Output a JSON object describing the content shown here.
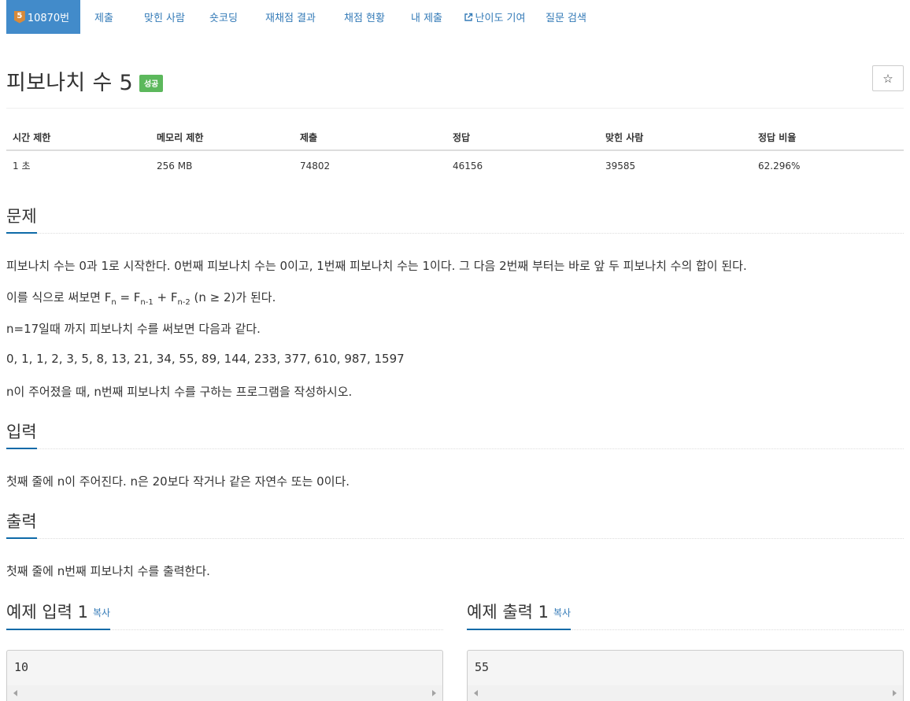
{
  "nav": {
    "problem_number": "10870번",
    "tier_level": "5",
    "items": [
      "제출",
      "맞힌 사람",
      "숏코딩",
      "재채점 결과",
      "채점 현황",
      "내 제출",
      "난이도 기여",
      "질문 검색"
    ]
  },
  "problem": {
    "title": "피보나치 수 5",
    "result_badge": "성공",
    "star_symbol": "☆"
  },
  "info_table": {
    "headers": [
      "시간 제한",
      "메모리 제한",
      "제출",
      "정답",
      "맞힌 사람",
      "정답 비율"
    ],
    "values": [
      "1 초",
      "256 MB",
      "74802",
      "46156",
      "39585",
      "62.296%"
    ]
  },
  "sections": {
    "description_title": "문제",
    "description": {
      "line1": "피보나치 수는 0과 1로 시작한다. 0번째 피보나치 수는 0이고, 1번째 피보나치 수는 1이다. 그 다음 2번째 부터는 바로 앞 두 피보나치 수의 합이 된다.",
      "line2_prefix": "이를 식으로 써보면 F",
      "sub_n": "n",
      "line2_eq": " = F",
      "sub_n1": "n-1",
      "line2_plus": " + F",
      "sub_n2": "n-2",
      "line2_suffix": " (n ≥ 2)가 된다.",
      "line3": "n=17일때 까지 피보나치 수를 써보면 다음과 같다.",
      "line4": "0, 1, 1, 2, 3, 5, 8, 13, 21, 34, 55, 89, 144, 233, 377, 610, 987, 1597",
      "line5": "n이 주어졌을 때, n번째 피보나치 수를 구하는 프로그램을 작성하시오."
    },
    "input_title": "입력",
    "input_text": "첫째 줄에 n이 주어진다. n은 20보다 작거나 같은 자연수 또는 0이다.",
    "output_title": "출력",
    "output_text": "첫째 줄에 n번째 피보나치 수를 출력한다."
  },
  "samples": {
    "input_title": "예제 입력 1",
    "output_title": "예제 출력 1",
    "copy_label": "복사",
    "input_value": "10",
    "output_value": "55"
  },
  "colors": {
    "accent": "#428bca",
    "link": "#337ab7",
    "success": "#5cb85c",
    "section_underline": "#0e6aa8",
    "tier_bronze": "#d88a3a"
  }
}
